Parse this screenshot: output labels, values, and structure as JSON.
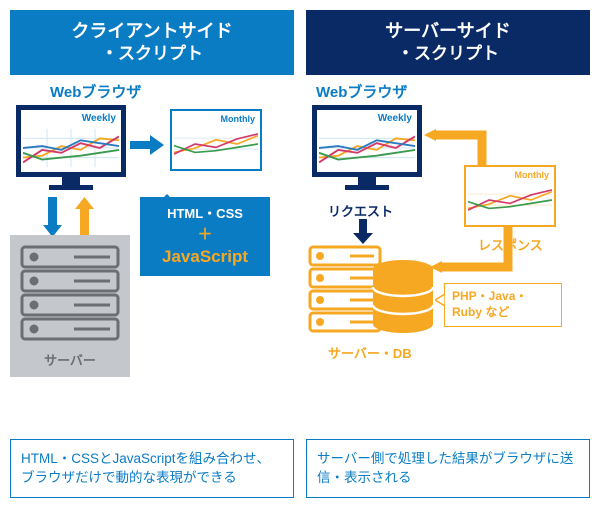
{
  "left": {
    "title_line1": "クライアントサイド",
    "title_line2": "・スクリプト",
    "browser_label": "Webブラウザ",
    "monitor1_label": "Weekly",
    "monitor2_label": "Monthly",
    "callout_line1": "HTML・CSS",
    "callout_plus": "＋",
    "callout_js": "JavaScript",
    "server_label": "サーバー",
    "footer": "HTML・CSSとJavaScriptを組み合わせ、ブラウザだけで動的な表現ができる"
  },
  "right": {
    "title_line1": "サーバーサイド",
    "title_line2": "・スクリプト",
    "browser_label": "Webブラウザ",
    "monitor1_label": "Weekly",
    "monitor2_label": "Monthly",
    "request_label": "リクエスト",
    "response_label": "レスポンス",
    "server_label": "サーバー・DB",
    "lang_label": "PHP・Java・Ruby など",
    "footer": "サーバー側で処理した結果がブラウザに送信・表示される"
  }
}
